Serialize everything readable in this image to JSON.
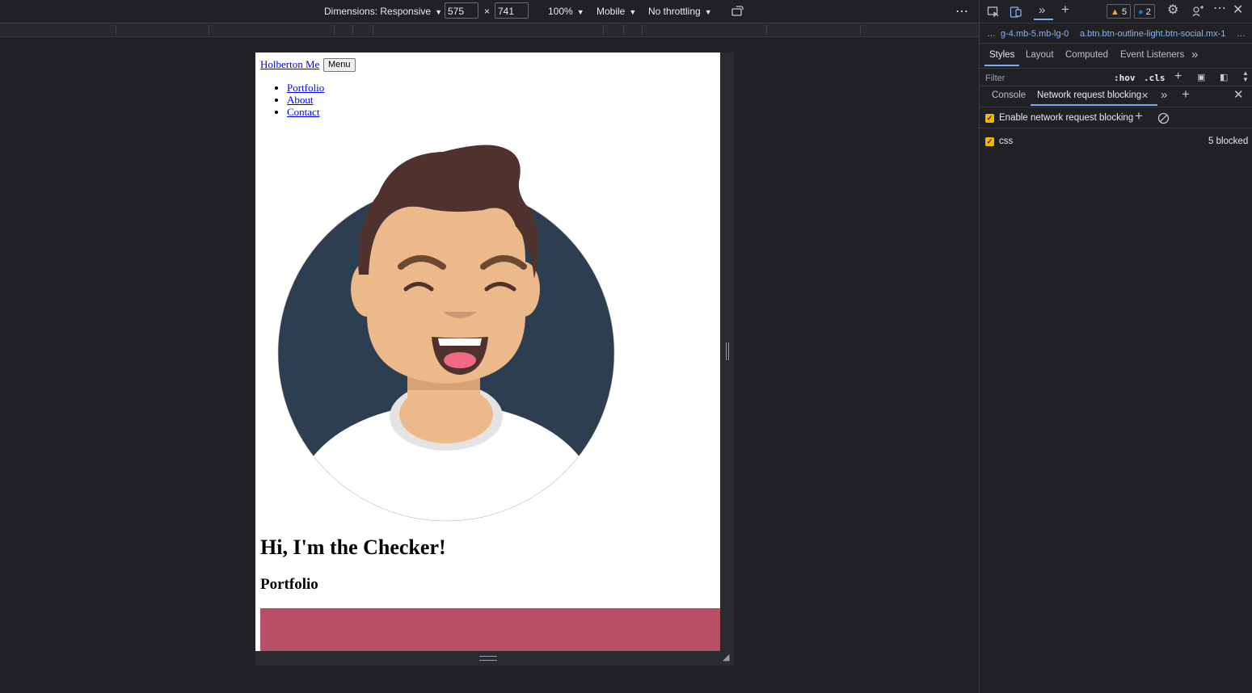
{
  "device_toolbar": {
    "dimensions_label": "Dimensions: Responsive",
    "width_value": "575",
    "times": "×",
    "height_value": "741",
    "zoom": "100%",
    "device_type": "Mobile",
    "throttling": "No throttling",
    "more_icon": "⋯"
  },
  "page": {
    "brand": "Holberton Me",
    "menu_button": "Menu",
    "nav": [
      "Portfolio",
      "About",
      "Contact"
    ],
    "hero_title": "Hi, I'm the Checker!",
    "section_title": "Portfolio",
    "card_color": "#b84f65"
  },
  "devtools": {
    "warnings_count": "5",
    "info_count": "2",
    "breadcrumbs": [
      "g-4.mb-5.mb-lg-0",
      "a.btn.btn-outline-light.btn-social.mx-1"
    ],
    "breadcrumb_ellipsis": "…",
    "tabs": [
      "Styles",
      "Layout",
      "Computed",
      "Event Listeners"
    ],
    "filter_placeholder": "Filter",
    "hov": ":hov",
    "cls": ".cls",
    "drawer_tabs": [
      "Console",
      "Network request blocking"
    ],
    "enable_label": "Enable network request blocking",
    "pattern": "css",
    "blocked_count": "5 blocked"
  }
}
